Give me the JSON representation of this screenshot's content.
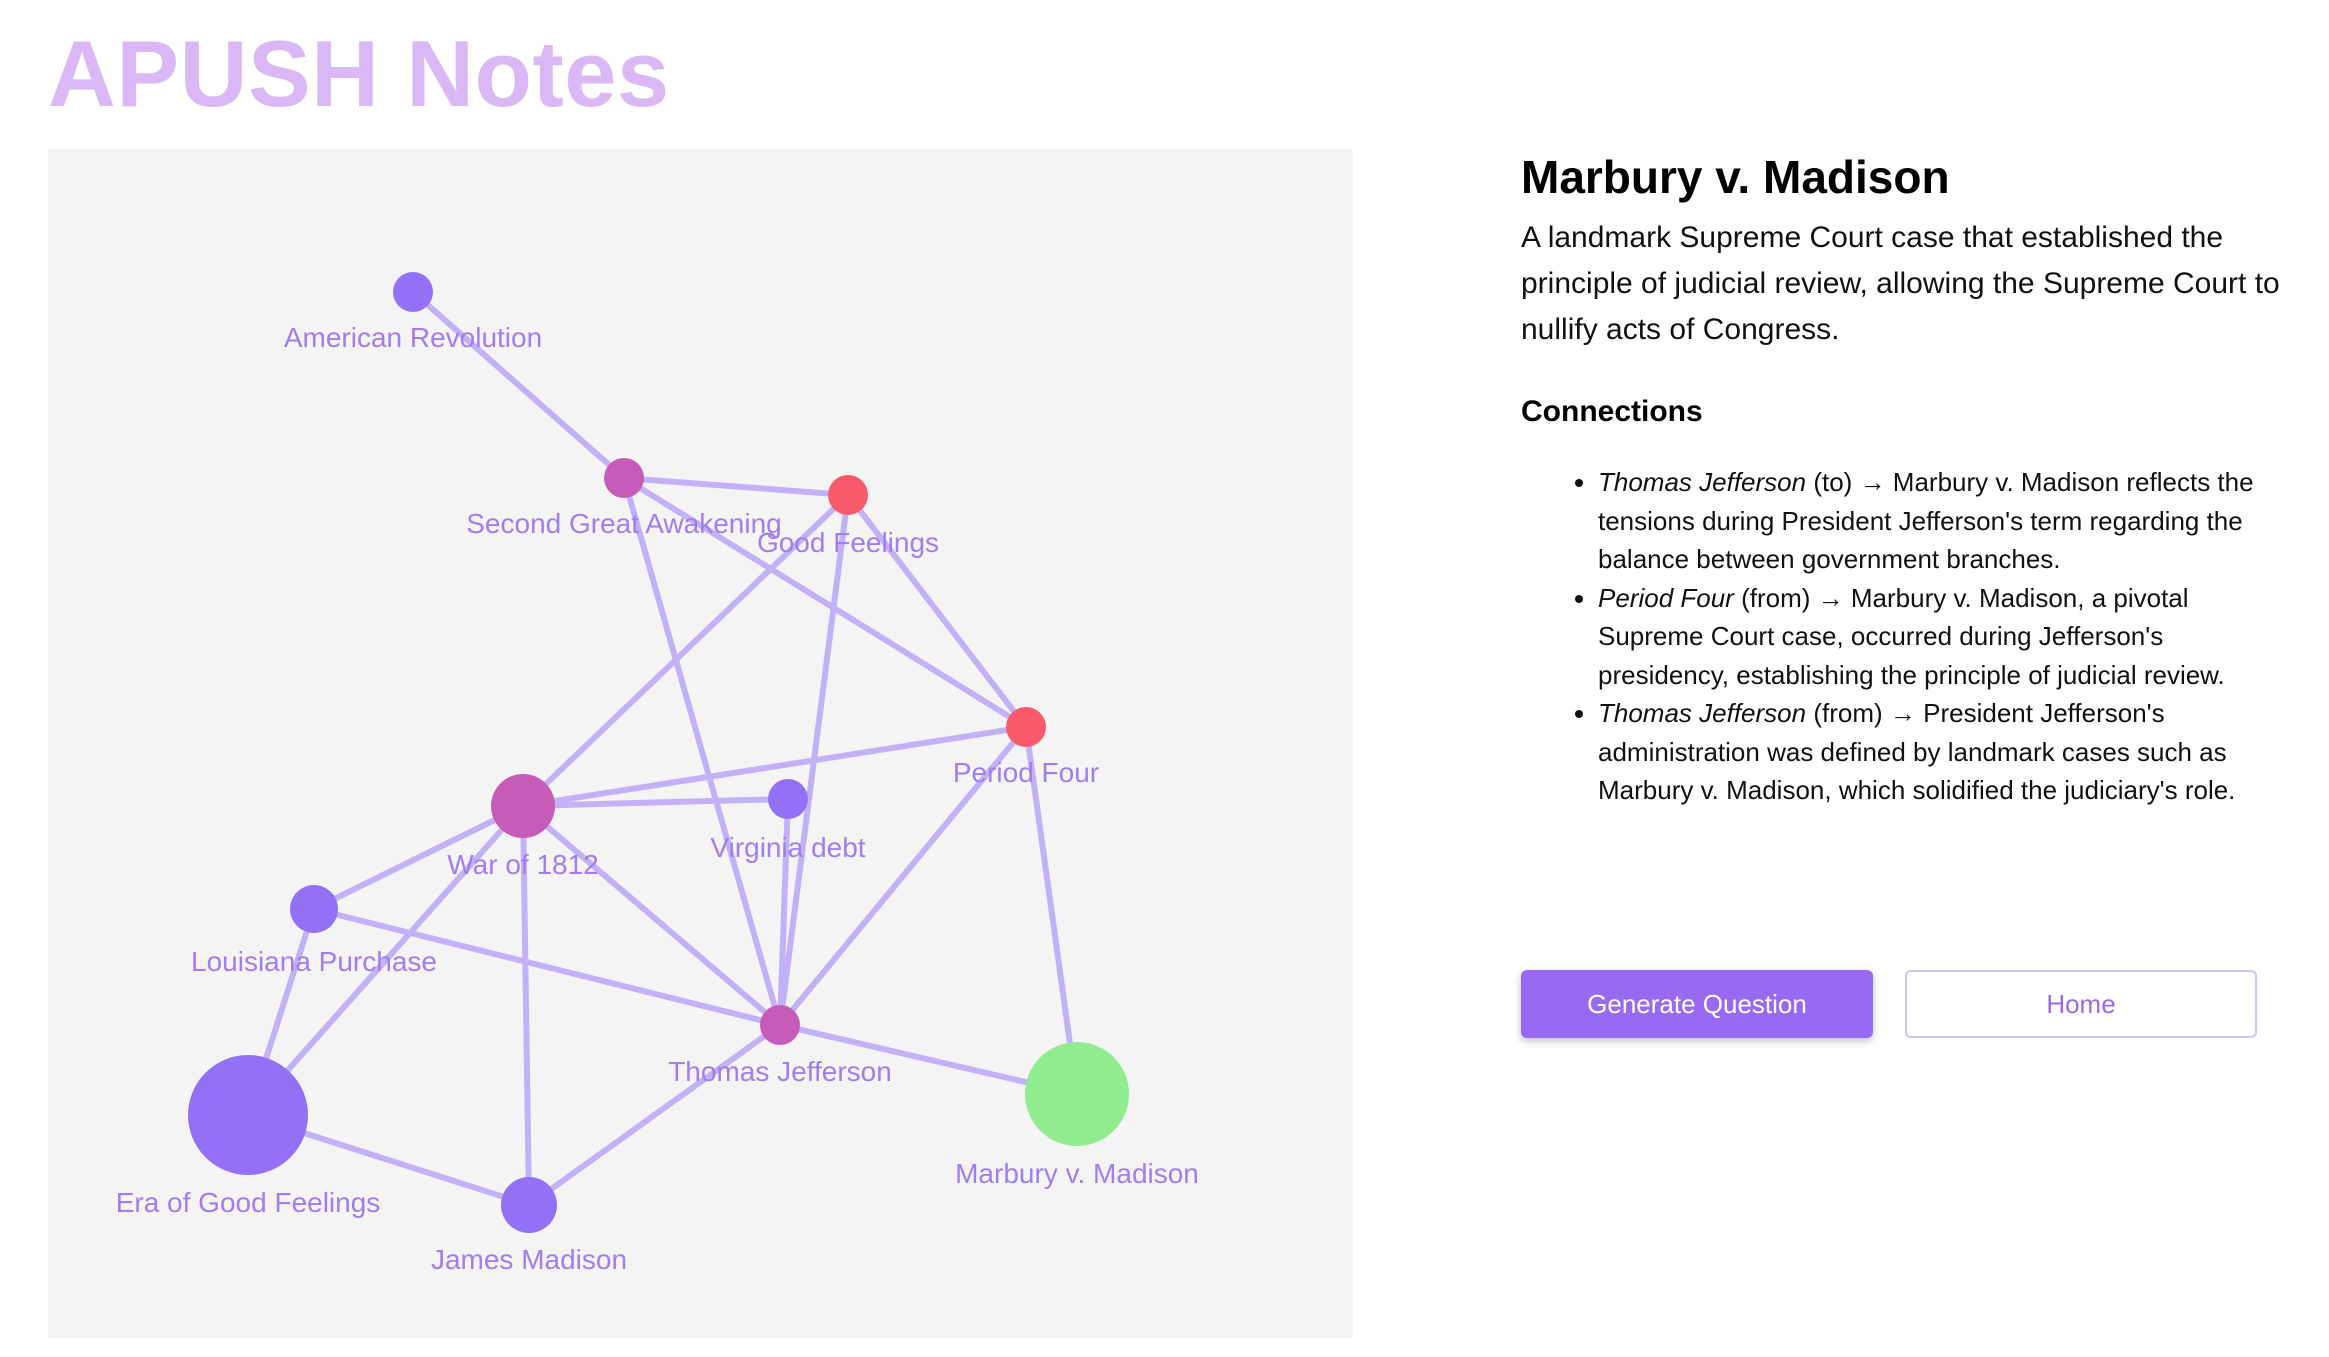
{
  "app": {
    "title": "APUSH Notes"
  },
  "colors": {
    "title": "#d9b8f5",
    "edge": "#c3b1f7",
    "label": "#a27cf2",
    "node_default": "#9470f7",
    "node_hub": "#c65bb8",
    "node_hot": "#fa5b6c",
    "node_selected": "#90ec8f",
    "button_primary": "#9a69f3"
  },
  "graph": {
    "nodes": [
      {
        "id": "american-revolution",
        "label": "American Revolution",
        "color": "#9470f7"
      },
      {
        "id": "second-great-awakening",
        "label": "Second Great Awakening",
        "color": "#c65bb8"
      },
      {
        "id": "good-feelings",
        "label": "Good Feelings",
        "color": "#fa5b6c"
      },
      {
        "id": "period-four",
        "label": "Period Four",
        "color": "#fa5b6c"
      },
      {
        "id": "war-of-1812",
        "label": "War of 1812",
        "color": "#c65bb8"
      },
      {
        "id": "virginia-debt",
        "label": "Virginia debt",
        "color": "#9470f7"
      },
      {
        "id": "louisiana-purchase",
        "label": "Louisiana Purchase",
        "color": "#9470f7"
      },
      {
        "id": "thomas-jefferson",
        "label": "Thomas Jefferson",
        "color": "#c65bb8"
      },
      {
        "id": "era-of-good-feelings",
        "label": "Era of Good Feelings",
        "color": "#9470f7"
      },
      {
        "id": "marbury-v-madison",
        "label": "Marbury v. Madison",
        "color": "#90ec8f",
        "selected": true
      },
      {
        "id": "james-madison",
        "label": "James Madison",
        "color": "#9470f7"
      }
    ],
    "edges": [
      [
        "american-revolution",
        "second-great-awakening"
      ],
      [
        "second-great-awakening",
        "good-feelings"
      ],
      [
        "second-great-awakening",
        "period-four"
      ],
      [
        "second-great-awakening",
        "thomas-jefferson"
      ],
      [
        "good-feelings",
        "war-of-1812"
      ],
      [
        "good-feelings",
        "thomas-jefferson"
      ],
      [
        "good-feelings",
        "period-four"
      ],
      [
        "period-four",
        "war-of-1812"
      ],
      [
        "period-four",
        "thomas-jefferson"
      ],
      [
        "period-four",
        "marbury-v-madison"
      ],
      [
        "war-of-1812",
        "virginia-debt"
      ],
      [
        "war-of-1812",
        "louisiana-purchase"
      ],
      [
        "war-of-1812",
        "thomas-jefferson"
      ],
      [
        "war-of-1812",
        "era-of-good-feelings"
      ],
      [
        "war-of-1812",
        "james-madison"
      ],
      [
        "virginia-debt",
        "thomas-jefferson"
      ],
      [
        "louisiana-purchase",
        "thomas-jefferson"
      ],
      [
        "louisiana-purchase",
        "era-of-good-feelings"
      ],
      [
        "thomas-jefferson",
        "marbury-v-madison"
      ],
      [
        "thomas-jefferson",
        "james-madison"
      ],
      [
        "era-of-good-feelings",
        "james-madison"
      ]
    ]
  },
  "detail": {
    "title": "Marbury v. Madison",
    "description": "A landmark Supreme Court case that established the principle of judicial review, allowing the Supreme Court to nullify acts of Congress.",
    "connections_heading": "Connections",
    "connections": [
      {
        "name": "Thomas Jefferson",
        "direction": "(to)",
        "arrow": "→",
        "text": "Marbury v. Madison reflects the tensions during President Jefferson's term regarding the balance between government branches."
      },
      {
        "name": "Period Four",
        "direction": "(from)",
        "arrow": "→",
        "text": "Marbury v. Madison, a pivotal Supreme Court case, occurred during Jefferson's presidency, establishing the principle of judicial review."
      },
      {
        "name": "Thomas Jefferson",
        "direction": "(from)",
        "arrow": "→",
        "text": "President Jefferson's administration was defined by landmark cases such as Marbury v. Madison, which solidified the judiciary's role."
      }
    ]
  },
  "buttons": {
    "generate_question": "Generate Question",
    "home": "Home"
  }
}
